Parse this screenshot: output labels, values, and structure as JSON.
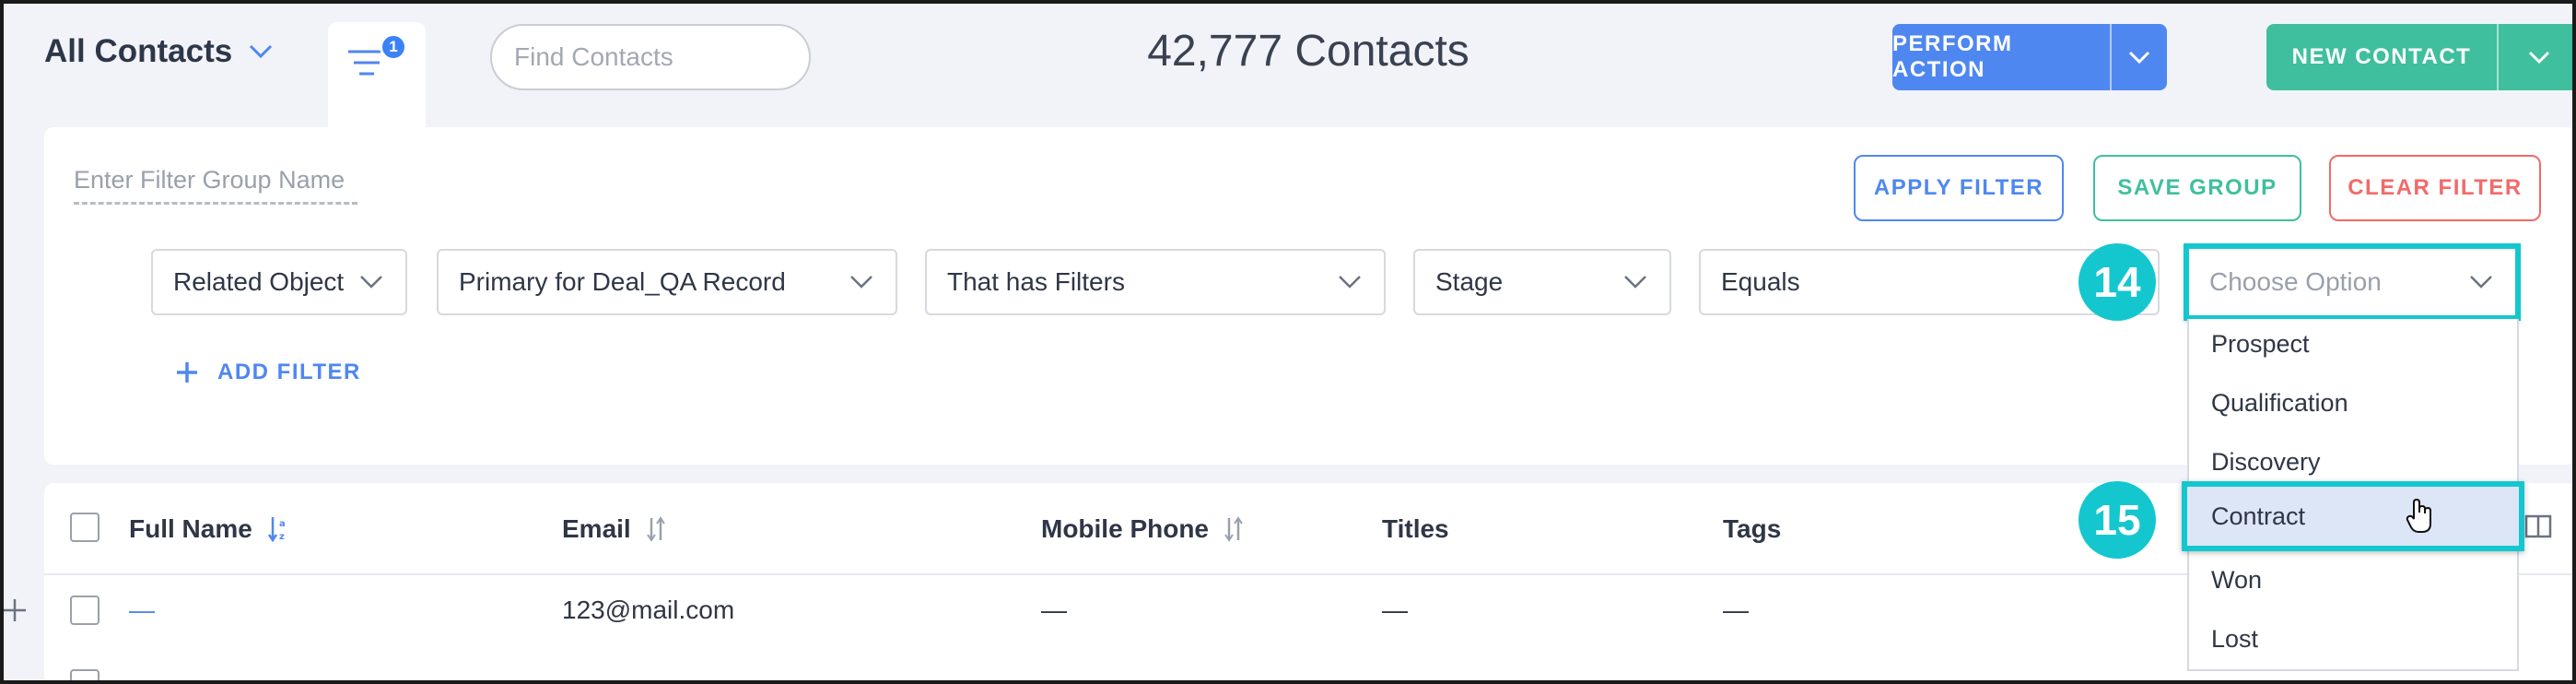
{
  "header": {
    "view_title": "All Contacts",
    "filter_badge": "1",
    "search_placeholder": "Find Contacts",
    "contacts_count": "42,777 Contacts",
    "perform_action_label": "PERFORM ACTION",
    "new_contact_label": "NEW CONTACT"
  },
  "filter_panel": {
    "group_name_placeholder": "Enter Filter Group Name",
    "apply_label": "APPLY FILTER",
    "save_label": "SAVE GROUP",
    "clear_label": "CLEAR FILTER",
    "selects": [
      {
        "value": "Related Object"
      },
      {
        "value": "Primary for Deal_QA Record"
      },
      {
        "value": "That has Filters"
      },
      {
        "value": "Stage"
      },
      {
        "value": "Equals"
      }
    ],
    "value_select_placeholder": "Choose Option",
    "add_filter_label": "ADD FILTER",
    "options": [
      "Prospect",
      "Qualification",
      "Discovery",
      "Contract",
      "Won",
      "Lost"
    ],
    "highlighted_option": "Contract"
  },
  "callouts": {
    "first": "14",
    "second": "15"
  },
  "table": {
    "columns": [
      "Full Name",
      "Email",
      "Mobile Phone",
      "Titles",
      "Tags"
    ],
    "rows": [
      {
        "full_name": "—",
        "email": "123@mail.com",
        "mobile_phone": "—",
        "titles": "—",
        "tags": "—"
      }
    ]
  },
  "colors": {
    "primary_blue": "#4f87f0",
    "teal": "#3fbf9e",
    "red": "#f26a6a",
    "callout_cyan": "#14c7cf"
  }
}
